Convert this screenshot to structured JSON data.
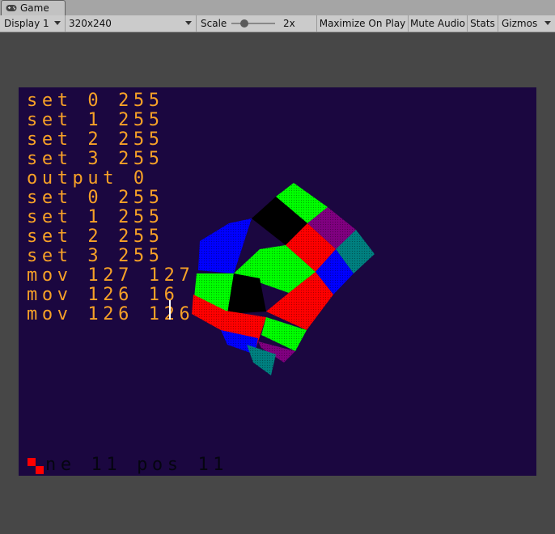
{
  "window": {
    "tab_label": "Game",
    "tab_icon": "gamepad-icon"
  },
  "toolbar": {
    "display": "Display 1",
    "resolution": "320x240",
    "scale_label": "Scale",
    "scale_value": "2x",
    "scale_slider_fraction": 0.3,
    "maximize": "Maximize On Play",
    "mute": "Mute Audio",
    "stats": "Stats",
    "gizmos": "Gizmos"
  },
  "game": {
    "background": "#1b0740",
    "text_color": "#f7a127",
    "console_lines": [
      "set 0 255",
      "set 1 255",
      "set 2 255",
      "set 3 255",
      "output 0",
      "set 0 255",
      "set 1 255",
      "set 2 255",
      "set 3 255",
      "mov 127 127",
      "mov 126 16",
      "mov 126 126"
    ],
    "status_line": "ne 11 pos 11",
    "face_colors": {
      "green": "#00ff00",
      "red": "#ff0000",
      "blue": "#0000ff",
      "black": "#000000",
      "purple": "#800080",
      "teal": "#008080"
    }
  }
}
